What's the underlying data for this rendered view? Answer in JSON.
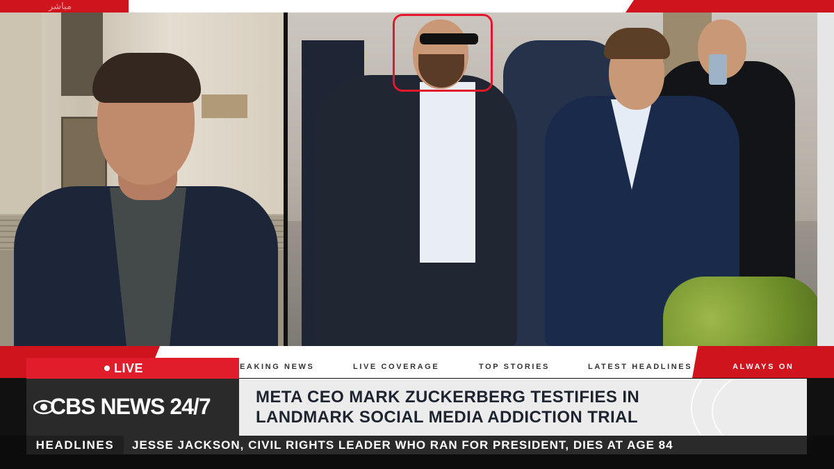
{
  "top_banner": {
    "faint_text": "مباشر"
  },
  "photo": {
    "highlight_color": "#e4162a"
  },
  "ticker": {
    "items": [
      "EAKING NEWS",
      "LIVE COVERAGE",
      "TOP STORIES",
      "LATEST HEADLINES",
      "ALWAYS ON"
    ]
  },
  "live": {
    "label": "LIVE"
  },
  "logo": {
    "text": "CBS NEWS 24/7",
    "icon": "cbs-eye-icon"
  },
  "headline": {
    "line1": "META CEO MARK ZUCKERBERG TESTIFIES IN",
    "line2": "LANDMARK SOCIAL MEDIA ADDICTION TRIAL"
  },
  "bottom_bar": {
    "label": "HEADLINES",
    "text": "JESSE JACKSON, CIVIL RIGHTS LEADER WHO RAN FOR PRESIDENT, DIES AT AGE 84"
  },
  "colors": {
    "brand_red": "#d0141d",
    "live_red": "#e11d2b",
    "headline_text": "#1e2430"
  }
}
